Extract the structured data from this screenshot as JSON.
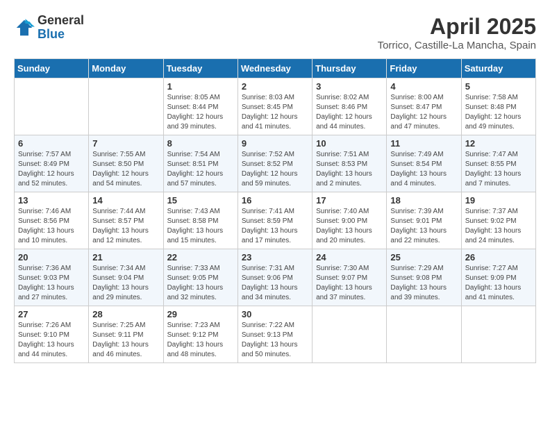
{
  "header": {
    "logo_general": "General",
    "logo_blue": "Blue",
    "title": "April 2025",
    "subtitle": "Torrico, Castille-La Mancha, Spain"
  },
  "days_of_week": [
    "Sunday",
    "Monday",
    "Tuesday",
    "Wednesday",
    "Thursday",
    "Friday",
    "Saturday"
  ],
  "weeks": [
    [
      {
        "day": "",
        "sunrise": "",
        "sunset": "",
        "daylight": ""
      },
      {
        "day": "",
        "sunrise": "",
        "sunset": "",
        "daylight": ""
      },
      {
        "day": "1",
        "sunrise": "Sunrise: 8:05 AM",
        "sunset": "Sunset: 8:44 PM",
        "daylight": "Daylight: 12 hours and 39 minutes."
      },
      {
        "day": "2",
        "sunrise": "Sunrise: 8:03 AM",
        "sunset": "Sunset: 8:45 PM",
        "daylight": "Daylight: 12 hours and 41 minutes."
      },
      {
        "day": "3",
        "sunrise": "Sunrise: 8:02 AM",
        "sunset": "Sunset: 8:46 PM",
        "daylight": "Daylight: 12 hours and 44 minutes."
      },
      {
        "day": "4",
        "sunrise": "Sunrise: 8:00 AM",
        "sunset": "Sunset: 8:47 PM",
        "daylight": "Daylight: 12 hours and 47 minutes."
      },
      {
        "day": "5",
        "sunrise": "Sunrise: 7:58 AM",
        "sunset": "Sunset: 8:48 PM",
        "daylight": "Daylight: 12 hours and 49 minutes."
      }
    ],
    [
      {
        "day": "6",
        "sunrise": "Sunrise: 7:57 AM",
        "sunset": "Sunset: 8:49 PM",
        "daylight": "Daylight: 12 hours and 52 minutes."
      },
      {
        "day": "7",
        "sunrise": "Sunrise: 7:55 AM",
        "sunset": "Sunset: 8:50 PM",
        "daylight": "Daylight: 12 hours and 54 minutes."
      },
      {
        "day": "8",
        "sunrise": "Sunrise: 7:54 AM",
        "sunset": "Sunset: 8:51 PM",
        "daylight": "Daylight: 12 hours and 57 minutes."
      },
      {
        "day": "9",
        "sunrise": "Sunrise: 7:52 AM",
        "sunset": "Sunset: 8:52 PM",
        "daylight": "Daylight: 12 hours and 59 minutes."
      },
      {
        "day": "10",
        "sunrise": "Sunrise: 7:51 AM",
        "sunset": "Sunset: 8:53 PM",
        "daylight": "Daylight: 13 hours and 2 minutes."
      },
      {
        "day": "11",
        "sunrise": "Sunrise: 7:49 AM",
        "sunset": "Sunset: 8:54 PM",
        "daylight": "Daylight: 13 hours and 4 minutes."
      },
      {
        "day": "12",
        "sunrise": "Sunrise: 7:47 AM",
        "sunset": "Sunset: 8:55 PM",
        "daylight": "Daylight: 13 hours and 7 minutes."
      }
    ],
    [
      {
        "day": "13",
        "sunrise": "Sunrise: 7:46 AM",
        "sunset": "Sunset: 8:56 PM",
        "daylight": "Daylight: 13 hours and 10 minutes."
      },
      {
        "day": "14",
        "sunrise": "Sunrise: 7:44 AM",
        "sunset": "Sunset: 8:57 PM",
        "daylight": "Daylight: 13 hours and 12 minutes."
      },
      {
        "day": "15",
        "sunrise": "Sunrise: 7:43 AM",
        "sunset": "Sunset: 8:58 PM",
        "daylight": "Daylight: 13 hours and 15 minutes."
      },
      {
        "day": "16",
        "sunrise": "Sunrise: 7:41 AM",
        "sunset": "Sunset: 8:59 PM",
        "daylight": "Daylight: 13 hours and 17 minutes."
      },
      {
        "day": "17",
        "sunrise": "Sunrise: 7:40 AM",
        "sunset": "Sunset: 9:00 PM",
        "daylight": "Daylight: 13 hours and 20 minutes."
      },
      {
        "day": "18",
        "sunrise": "Sunrise: 7:39 AM",
        "sunset": "Sunset: 9:01 PM",
        "daylight": "Daylight: 13 hours and 22 minutes."
      },
      {
        "day": "19",
        "sunrise": "Sunrise: 7:37 AM",
        "sunset": "Sunset: 9:02 PM",
        "daylight": "Daylight: 13 hours and 24 minutes."
      }
    ],
    [
      {
        "day": "20",
        "sunrise": "Sunrise: 7:36 AM",
        "sunset": "Sunset: 9:03 PM",
        "daylight": "Daylight: 13 hours and 27 minutes."
      },
      {
        "day": "21",
        "sunrise": "Sunrise: 7:34 AM",
        "sunset": "Sunset: 9:04 PM",
        "daylight": "Daylight: 13 hours and 29 minutes."
      },
      {
        "day": "22",
        "sunrise": "Sunrise: 7:33 AM",
        "sunset": "Sunset: 9:05 PM",
        "daylight": "Daylight: 13 hours and 32 minutes."
      },
      {
        "day": "23",
        "sunrise": "Sunrise: 7:31 AM",
        "sunset": "Sunset: 9:06 PM",
        "daylight": "Daylight: 13 hours and 34 minutes."
      },
      {
        "day": "24",
        "sunrise": "Sunrise: 7:30 AM",
        "sunset": "Sunset: 9:07 PM",
        "daylight": "Daylight: 13 hours and 37 minutes."
      },
      {
        "day": "25",
        "sunrise": "Sunrise: 7:29 AM",
        "sunset": "Sunset: 9:08 PM",
        "daylight": "Daylight: 13 hours and 39 minutes."
      },
      {
        "day": "26",
        "sunrise": "Sunrise: 7:27 AM",
        "sunset": "Sunset: 9:09 PM",
        "daylight": "Daylight: 13 hours and 41 minutes."
      }
    ],
    [
      {
        "day": "27",
        "sunrise": "Sunrise: 7:26 AM",
        "sunset": "Sunset: 9:10 PM",
        "daylight": "Daylight: 13 hours and 44 minutes."
      },
      {
        "day": "28",
        "sunrise": "Sunrise: 7:25 AM",
        "sunset": "Sunset: 9:11 PM",
        "daylight": "Daylight: 13 hours and 46 minutes."
      },
      {
        "day": "29",
        "sunrise": "Sunrise: 7:23 AM",
        "sunset": "Sunset: 9:12 PM",
        "daylight": "Daylight: 13 hours and 48 minutes."
      },
      {
        "day": "30",
        "sunrise": "Sunrise: 7:22 AM",
        "sunset": "Sunset: 9:13 PM",
        "daylight": "Daylight: 13 hours and 50 minutes."
      },
      {
        "day": "",
        "sunrise": "",
        "sunset": "",
        "daylight": ""
      },
      {
        "day": "",
        "sunrise": "",
        "sunset": "",
        "daylight": ""
      },
      {
        "day": "",
        "sunrise": "",
        "sunset": "",
        "daylight": ""
      }
    ]
  ]
}
